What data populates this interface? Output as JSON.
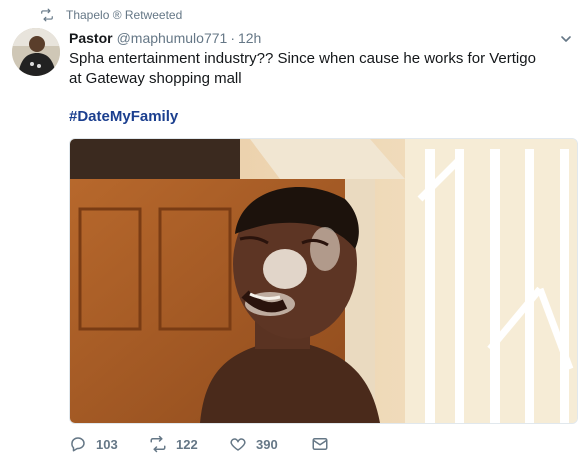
{
  "retweet_context": {
    "text": "Thapelo ® Retweeted",
    "icon": "retweet-icon"
  },
  "tweet": {
    "author": {
      "display_name": "Pastor",
      "handle": "@maphumulo771",
      "avatar": "avatar"
    },
    "separator": "·",
    "time": "12h",
    "text": "Spha entertainment industry?? Since when cause  he works for Vertigo at Gateway shopping mall",
    "hashtag": "#DateMyFamily",
    "media": {
      "kind": "photo",
      "subject": "person-face-photo"
    },
    "actions": {
      "reply_count": "103",
      "retweet_count": "122",
      "like_count": "390",
      "reply_icon": "reply-icon",
      "retweet_icon": "retweet-icon",
      "like_icon": "heart-icon",
      "message_icon": "envelope-icon"
    }
  },
  "colors": {
    "hashtag": "#1b3f8f",
    "secondary_text": "#657786",
    "primary_text": "#14171a"
  }
}
